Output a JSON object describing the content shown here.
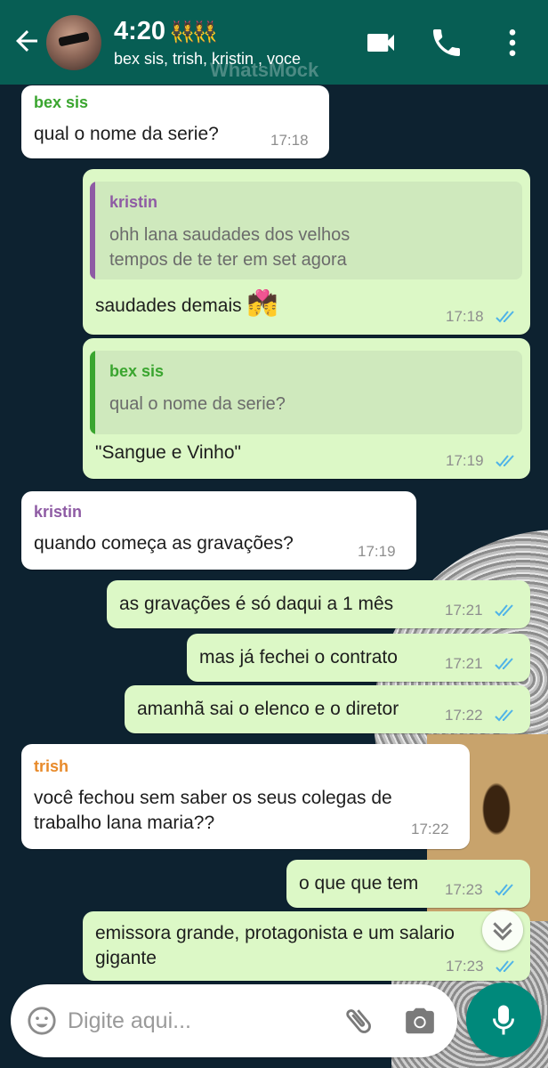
{
  "header": {
    "time_title": "4:20",
    "title_emoji": "👯‍♀️👯‍♀️",
    "participants": "bex sis, trish, kristin , voce",
    "watermark": "WhatsMock",
    "icons": [
      "back-arrow-icon",
      "video-call-icon",
      "phone-icon",
      "more-vert-icon"
    ]
  },
  "colors": {
    "header_bg": "#075e54",
    "outgoing_bubble": "#dcf8c6",
    "incoming_bubble": "#ffffff",
    "sender_bex": "#3aa52f",
    "sender_kristin": "#8e5ba4",
    "sender_trish": "#e88a2a",
    "read_ticks": "#4fb3e8",
    "mic_button": "#00897b"
  },
  "messages": [
    {
      "sender": "bex sis",
      "text": "qual o nome da serie?",
      "time": "17:18"
    },
    {
      "quote_sender": "kristin",
      "quote_line1": "ohh lana saudades dos velhos",
      "quote_line2": "tempos de te ter em set agora",
      "text": "saudades demais",
      "emoji": "💏",
      "time": "17:18"
    },
    {
      "quote_sender": "bex sis",
      "quote_line1": "qual o nome da serie?",
      "text": "\"Sangue e Vinho\"",
      "time": "17:19"
    },
    {
      "sender": "kristin",
      "text": "quando começa as gravações?",
      "time": "17:19"
    },
    {
      "text": "as gravações é só daqui a 1 mês",
      "time": "17:21"
    },
    {
      "text": "mas já fechei o contrato",
      "time": "17:21"
    },
    {
      "text": "amanhã sai o elenco e o diretor",
      "time": "17:22"
    },
    {
      "sender": "trish",
      "line1": "você fechou sem saber os seus colegas de",
      "line2": "trabalho lana maria??",
      "time": "17:22"
    },
    {
      "text": "o que que tem",
      "time": "17:23"
    },
    {
      "line1": "emissora grande, protagonista e um salario",
      "line2": "gigante",
      "time": "17:23"
    }
  ],
  "input": {
    "placeholder": "Digite aqui...",
    "icons": [
      "emoji-icon",
      "attach-clip-icon",
      "camera-icon",
      "mic-icon"
    ]
  }
}
